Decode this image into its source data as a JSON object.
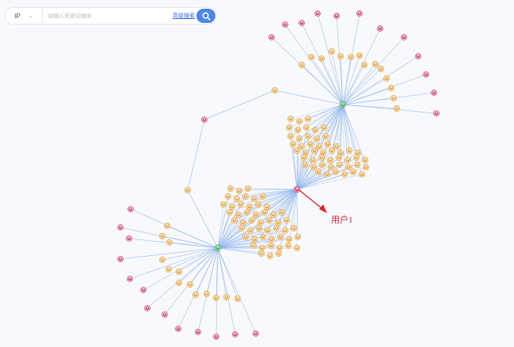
{
  "search": {
    "type_value": "IP",
    "placeholder": "请输入关键词搜索",
    "advanced_label": "高级搜索"
  },
  "graph": {
    "annotation": "用户1",
    "colors": {
      "edge": "#8eb3ec",
      "user_node": "#d22e6a",
      "host_node": "#e6a23c",
      "hub_node": "#3aa657",
      "arrow": "#e0202a"
    }
  }
}
